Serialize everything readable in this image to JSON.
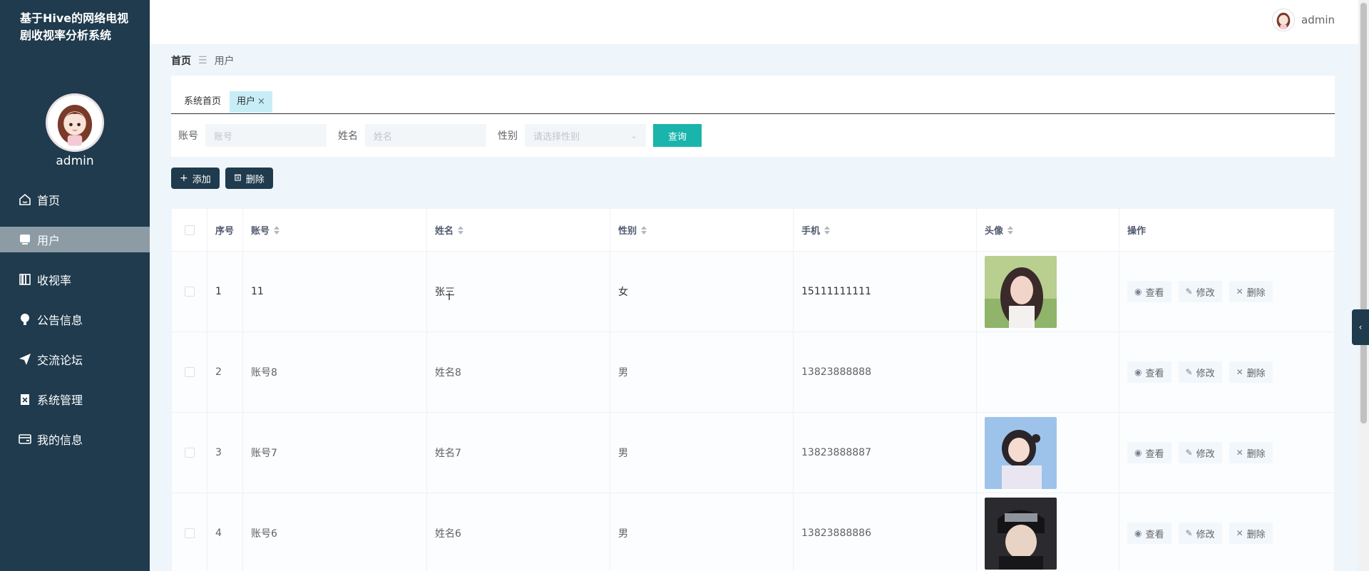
{
  "app": {
    "title": "基于Hive的网络电视剧收视率分析系统"
  },
  "sidebar": {
    "username": "admin",
    "items": [
      {
        "label": "首页",
        "icon": "home-icon"
      },
      {
        "label": "用户",
        "icon": "user-icon"
      },
      {
        "label": "收视率",
        "icon": "book-icon"
      },
      {
        "label": "公告信息",
        "icon": "bulb-icon"
      },
      {
        "label": "交流论坛",
        "icon": "send-icon"
      },
      {
        "label": "系统管理",
        "icon": "clipboard-icon"
      },
      {
        "label": "我的信息",
        "icon": "card-icon"
      }
    ],
    "active_index": 1
  },
  "header": {
    "username": "admin"
  },
  "breadcrumb": {
    "home": "首页",
    "current": "用户"
  },
  "tabs": [
    {
      "label": "系统首页"
    },
    {
      "label": "用户",
      "close": "×"
    }
  ],
  "filters": {
    "account_label": "账号",
    "account_placeholder": "账号",
    "name_label": "姓名",
    "name_placeholder": "姓名",
    "gender_label": "性别",
    "gender_placeholder": "请选择性别",
    "query_label": "查询"
  },
  "actions": {
    "add_label": "添加",
    "delete_label": "删除"
  },
  "table": {
    "columns": [
      "序号",
      "账号",
      "姓名",
      "性别",
      "手机",
      "头像",
      "操作"
    ],
    "ops": {
      "view": "查看",
      "edit": "修改",
      "delete": "删除"
    },
    "rows": [
      {
        "index": "1",
        "account": "11",
        "name": "张三",
        "gender": "女",
        "phone": "15111111111",
        "has_avatar": true
      },
      {
        "index": "2",
        "account": "账号8",
        "name": "姓名8",
        "gender": "男",
        "phone": "13823888888",
        "has_avatar": false
      },
      {
        "index": "3",
        "account": "账号7",
        "name": "姓名7",
        "gender": "男",
        "phone": "13823888887",
        "has_avatar": true
      },
      {
        "index": "4",
        "account": "账号6",
        "name": "姓名6",
        "gender": "男",
        "phone": "13823888886",
        "has_avatar": true
      }
    ]
  },
  "colors": {
    "sidebar": "#1f3b4d",
    "accent": "#19b4ac",
    "active_tab": "#c7eef6",
    "menu_active": "#8c9ba4"
  }
}
